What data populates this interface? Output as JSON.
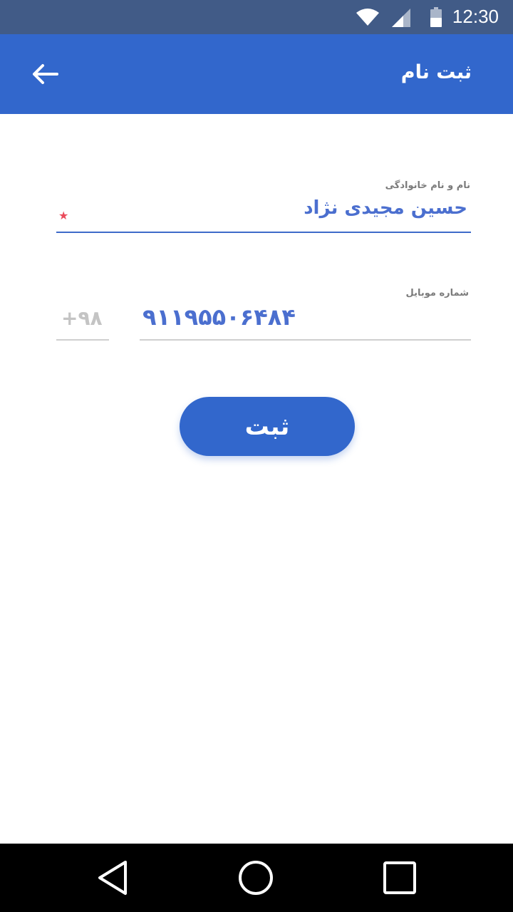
{
  "status_bar": {
    "time": "12:30",
    "icons": [
      "wifi-icon",
      "cell-signal-icon",
      "battery-icon"
    ]
  },
  "app_bar": {
    "title": "ثبت نام",
    "back_icon": "arrow-left-icon"
  },
  "form": {
    "name_field": {
      "label": "نام و نام خانوادگی",
      "value": "حسین مجیدی نژاد",
      "required_marker": "★"
    },
    "mobile_field": {
      "label": "شماره موبایل",
      "value": "۹۱۱۹۵۵۰۶۴۸۴",
      "prefix": "+۹۸"
    },
    "submit_label": "ثبت"
  },
  "nav_bar": {
    "icons": [
      "back-triangle-icon",
      "home-circle-icon",
      "recents-square-icon"
    ]
  },
  "colors": {
    "status_bar": "#415b87",
    "primary": "#3267cc",
    "field_text": "#4b6fcf",
    "label": "#7b7b7b",
    "required": "#ea4b5b",
    "inactive_line": "#cfcfcf"
  }
}
